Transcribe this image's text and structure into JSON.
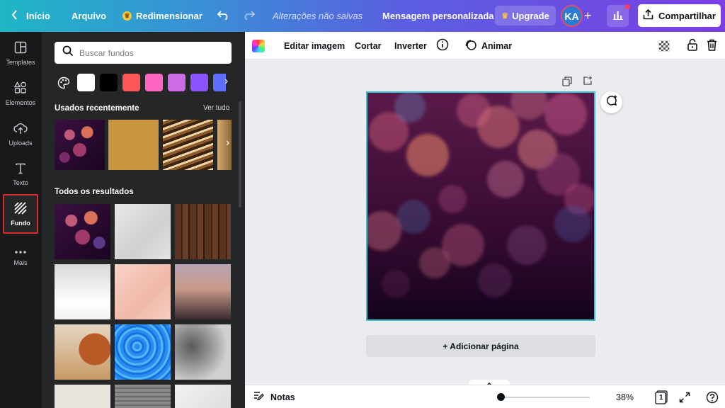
{
  "topbar": {
    "back_label": "Início",
    "file_label": "Arquivo",
    "resize_label": "Redimensionar",
    "save_status": "Alterações não salvas",
    "doc_title": "Mensagem personalizada",
    "upgrade_label": "Upgrade",
    "avatar_initials": "KA",
    "share_label": "Compartilhar"
  },
  "rail": {
    "items": [
      {
        "label": "Templates",
        "icon": "templates-icon"
      },
      {
        "label": "Elementos",
        "icon": "elements-icon"
      },
      {
        "label": "Uploads",
        "icon": "upload-icon"
      },
      {
        "label": "Texto",
        "icon": "text-icon"
      },
      {
        "label": "Fundo",
        "icon": "background-icon",
        "active": true
      },
      {
        "label": "Mais",
        "icon": "more-icon"
      }
    ]
  },
  "panel": {
    "search_placeholder": "Buscar fundos",
    "swatch_colors": [
      "#ffffff",
      "#000000",
      "#ff5757",
      "#ff66c4",
      "#cb6ce6",
      "#8c52ff",
      "#5e6eff"
    ],
    "recent_title": "Usados recentemente",
    "see_all": "Ver tudo",
    "results_title": "Todos os resultados"
  },
  "toolbar": {
    "edit_image": "Editar imagem",
    "crop": "Cortar",
    "flip": "Inverter",
    "animate": "Animar"
  },
  "canvas": {
    "add_page": "+ Adicionar página"
  },
  "bottombar": {
    "notes": "Notas",
    "zoom": "38%",
    "page_count": "1"
  },
  "colors": {
    "accent_border": "#35c4d4",
    "active_highlight": "#e0282e"
  }
}
